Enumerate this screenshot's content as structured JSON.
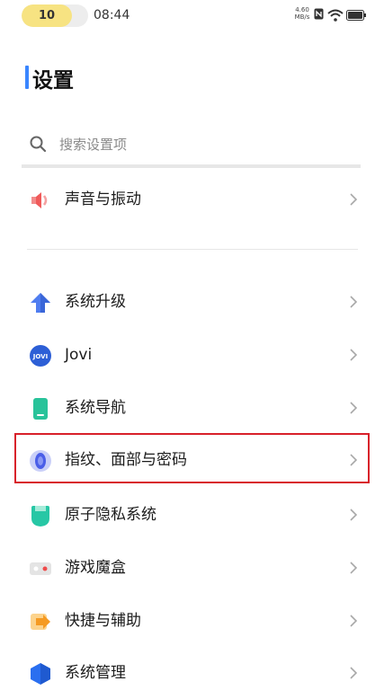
{
  "status_bar": {
    "badge": "10",
    "time": "08:44",
    "net_speed_value": "4.60",
    "net_speed_unit": "MB/s",
    "icons": [
      "nfc-icon",
      "wifi-icon",
      "battery-icon"
    ]
  },
  "page": {
    "title": "设置",
    "accent_color": "#3a86ff",
    "highlight_color": "#d8202a"
  },
  "search": {
    "placeholder": "搜索设置项",
    "value": ""
  },
  "items": [
    {
      "label": "声音与振动",
      "icon": "speaker-icon"
    },
    {
      "label": "系统升级",
      "icon": "system-update-icon"
    },
    {
      "label": "Jovi",
      "icon": "jovi-icon",
      "icon_text": "JOVI"
    },
    {
      "label": "系统导航",
      "icon": "navigation-icon"
    },
    {
      "label": "指纹、面部与密码",
      "icon": "fingerprint-icon"
    },
    {
      "label": "原子隐私系统",
      "icon": "privacy-icon"
    },
    {
      "label": "游戏魔盒",
      "icon": "game-box-icon"
    },
    {
      "label": "快捷与辅助",
      "icon": "shortcut-icon"
    },
    {
      "label": "系统管理",
      "icon": "system-management-icon"
    }
  ]
}
